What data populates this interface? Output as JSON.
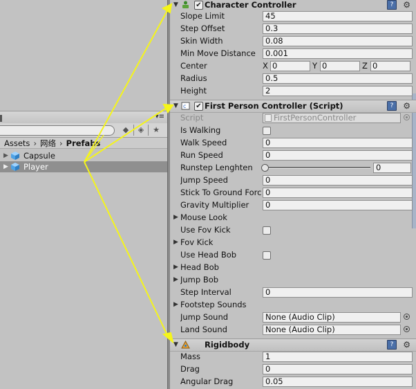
{
  "project": {
    "breadcrumb": [
      "Assets",
      "网络",
      "Prefabs"
    ],
    "assets": [
      {
        "name": "Capsule",
        "selected": false
      },
      {
        "name": "Player",
        "selected": true
      }
    ]
  },
  "character_controller": {
    "title": "Character Controller",
    "props": [
      {
        "label": "Slope Limit",
        "value": "45"
      },
      {
        "label": "Step Offset",
        "value": "0.3"
      },
      {
        "label": "Skin Width",
        "value": "0.08"
      },
      {
        "label": "Min Move Distance",
        "value": "0.001"
      }
    ],
    "center": {
      "label": "Center",
      "x_label": "X",
      "x": "0",
      "y_label": "Y",
      "y": "0",
      "z_label": "Z",
      "z": "0"
    },
    "radius": {
      "label": "Radius",
      "value": "0.5"
    },
    "height": {
      "label": "Height",
      "value": "2"
    }
  },
  "fps_controller": {
    "title": "First Person Controller (Script)",
    "script": {
      "label": "Script",
      "value": "FirstPersonController"
    },
    "is_walking": {
      "label": "Is Walking",
      "checked": false
    },
    "walk_speed": {
      "label": "Walk Speed",
      "value": "0"
    },
    "run_speed": {
      "label": "Run Speed",
      "value": "0"
    },
    "runstep": {
      "label": "Runstep Lenghten",
      "value": "0",
      "slider_level": 0
    },
    "jump_speed": {
      "label": "Jump Speed",
      "value": "0"
    },
    "stick_to_ground": {
      "label": "Stick To Ground Force",
      "value": "0"
    },
    "gravity_multiplier": {
      "label": "Gravity Multiplier",
      "value": "0"
    },
    "mouse_look": {
      "label": "Mouse Look"
    },
    "use_fov_kick": {
      "label": "Use Fov Kick",
      "checked": false
    },
    "fov_kick": {
      "label": "Fov Kick"
    },
    "use_head_bob": {
      "label": "Use Head Bob",
      "checked": false
    },
    "head_bob": {
      "label": "Head Bob"
    },
    "jump_bob": {
      "label": "Jump Bob"
    },
    "step_interval": {
      "label": "Step Interval",
      "value": "0"
    },
    "footstep_sounds": {
      "label": "Footstep Sounds"
    },
    "jump_sound": {
      "label": "Jump Sound",
      "value": "None (Audio Clip)"
    },
    "land_sound": {
      "label": "Land Sound",
      "value": "None (Audio Clip)"
    }
  },
  "rigidbody": {
    "title": "Rigidbody",
    "mass": {
      "label": "Mass",
      "value": "1"
    },
    "drag": {
      "label": "Drag",
      "value": "0"
    },
    "angular_drag": {
      "label": "Angular Drag",
      "value": "0.05"
    }
  },
  "colors": {
    "arrow": "#f5f51a",
    "selection": "#8f8f8f",
    "panel_bg": "#c2c2c2"
  }
}
